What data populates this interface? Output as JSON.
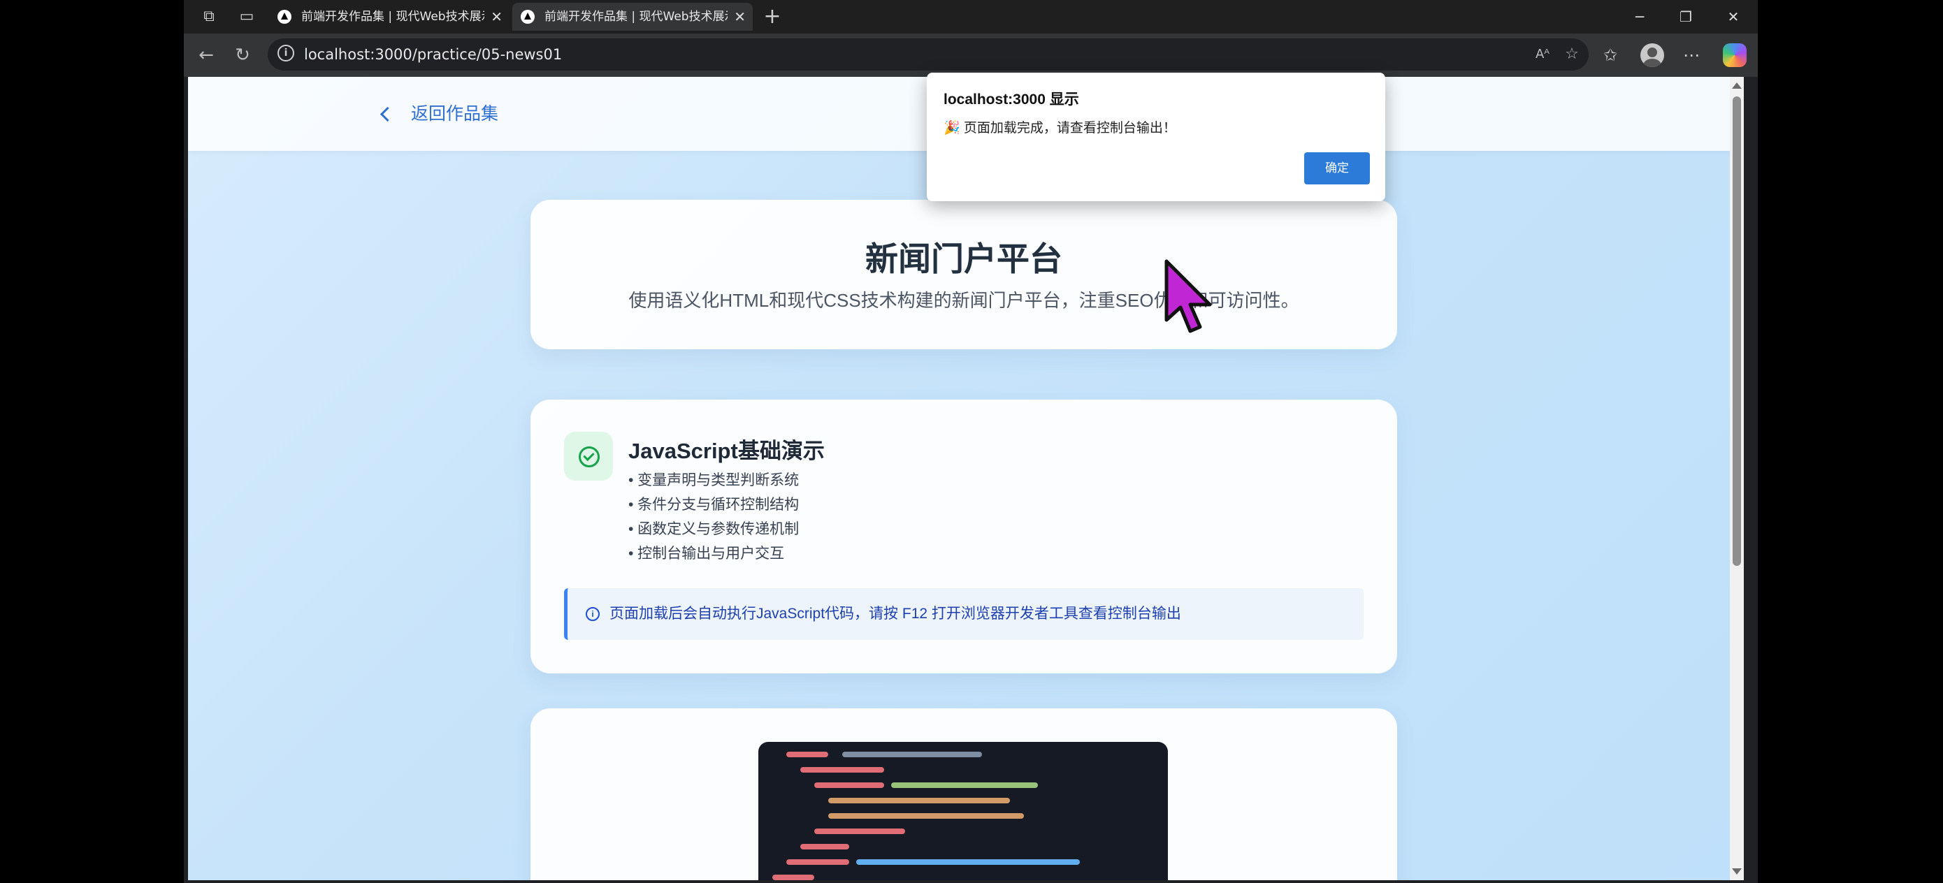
{
  "browser": {
    "tabs": [
      {
        "title": "前端开发作品集 | 现代Web技术展示",
        "active": false
      },
      {
        "title": "前端开发作品集 | 现代Web技术展示",
        "active": true
      }
    ],
    "new_tab_symbol": "+",
    "address": "localhost:3000/practice/05-news01",
    "icons": [
      "workspaces-icon",
      "tab-actions-icon",
      "back-icon",
      "refresh-icon",
      "site-info-icon",
      "read-aloud-icon",
      "favorite-icon",
      "favorites-icon",
      "profile-icon",
      "more-icon",
      "copilot-icon",
      "minimize-icon",
      "restore-icon",
      "close-icon"
    ]
  },
  "page": {
    "back_link": "返回作品集",
    "hero": {
      "title": "新闻门户平台",
      "subtitle": "使用语义化HTML和现代CSS技术构建的新闻门户平台，注重SEO优化和可访问性。"
    },
    "js_card": {
      "title": "JavaScript基础演示",
      "features": [
        "• 变量声明与类型判断系统",
        "• 条件分支与循环控制结构",
        "• 函数定义与参数传递机制",
        "• 控制台输出与用户交互"
      ],
      "note": "页面加载后会自动执行JavaScript代码，请按 F12 打开浏览器开发者工具查看控制台输出"
    }
  },
  "alert": {
    "title": "localhost:3000 显示",
    "message": "🎉 页面加载完成，请查看控制台输出！",
    "ok_label": "确定"
  },
  "colors": {
    "accent": "#2d7bd8",
    "link": "#2f6fd2",
    "success": "#16a34a",
    "cursor": "#c026d3"
  }
}
